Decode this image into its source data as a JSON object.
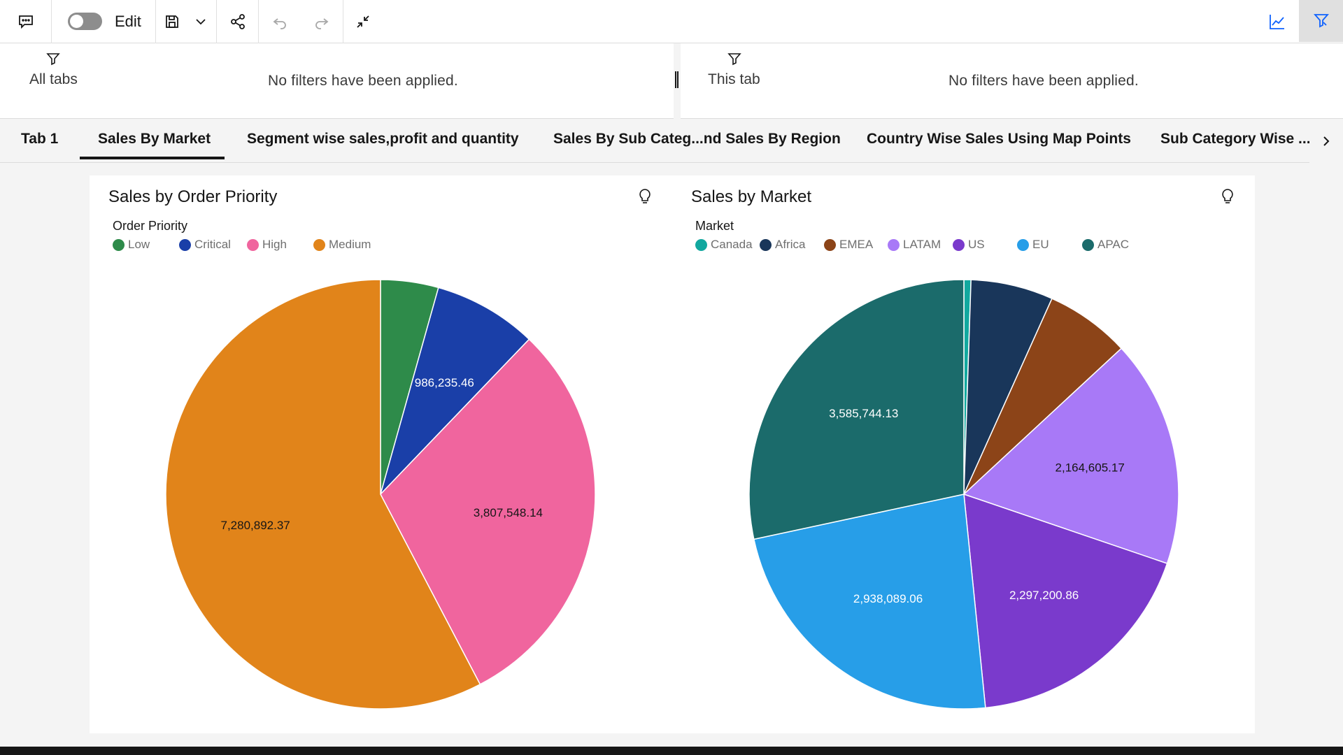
{
  "toolbar": {
    "edit_label": "Edit",
    "edit_toggle_on": false,
    "accent": "#0f62fe"
  },
  "filters": {
    "all_tabs_label": "All tabs",
    "all_tabs_message": "No filters have been applied.",
    "this_tab_label": "This tab",
    "this_tab_message": "No filters have been applied."
  },
  "tabs": [
    {
      "label": "Tab 1",
      "selected": false
    },
    {
      "label": "Sales By Market",
      "selected": true
    },
    {
      "label": "Segment wise sales,profit and quantity",
      "selected": false
    },
    {
      "label": "Sales By Sub Categ...nd Sales By Region",
      "selected": false
    },
    {
      "label": "Country Wise Sales Using Map Points",
      "selected": false
    },
    {
      "label": "Sub Category Wise ...L",
      "selected": false
    }
  ],
  "chart_data": [
    {
      "type": "pie",
      "title": "Sales by Order Priority",
      "legend_title": "Order Priority",
      "legend_placement": "top-left",
      "categories": [
        "Low",
        "Critical",
        "High",
        "Medium"
      ],
      "values": [
        549000,
        986235.46,
        3807548.14,
        7280892.37
      ],
      "value_labels": [
        "",
        "986,235.46",
        "3,807,548.14",
        "7,280,892.37"
      ],
      "colors": [
        "#2e8b4a",
        "#1a3fa8",
        "#f0659e",
        "#e1841a"
      ]
    },
    {
      "type": "pie",
      "title": "Sales by Market",
      "legend_title": "Market",
      "legend_placement": "top-left",
      "categories": [
        "Canada",
        "Africa",
        "EMEA",
        "LATAM",
        "US",
        "EU",
        "APAC"
      ],
      "values": [
        66928,
        783773,
        806162,
        2164605.17,
        2297200.86,
        2938089.06,
        3585744.13
      ],
      "value_labels": [
        "",
        "",
        "",
        "2,164,605.17",
        "2,297,200.86",
        "2,938,089.06",
        "3,585,744.13"
      ],
      "colors": [
        "#12a89f",
        "#19365a",
        "#8c4418",
        "#a879f7",
        "#7a3acc",
        "#279ee8",
        "#1b6b6b"
      ]
    }
  ]
}
